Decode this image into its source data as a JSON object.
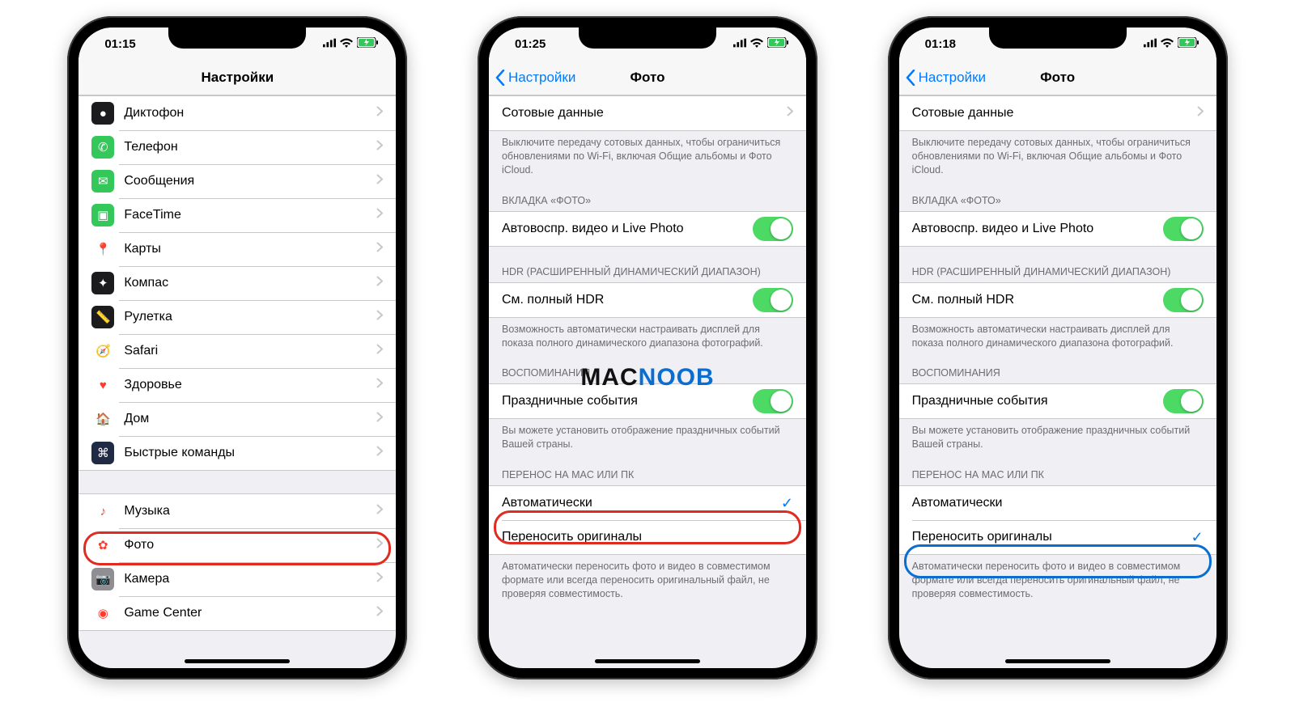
{
  "watermark": {
    "part1": "MAC",
    "part2": "NOOB"
  },
  "phone1": {
    "time": "01:15",
    "title": "Настройки",
    "items_g1": [
      {
        "label": "Диктофон",
        "icon_bg": "#1c1c1e",
        "glyph": "●"
      },
      {
        "label": "Телефон",
        "icon_bg": "#34c759",
        "glyph": "✆"
      },
      {
        "label": "Сообщения",
        "icon_bg": "#34c759",
        "glyph": "✉"
      },
      {
        "label": "FaceTime",
        "icon_bg": "#34c759",
        "glyph": "▣"
      },
      {
        "label": "Карты",
        "icon_bg": "#ffffff",
        "glyph": "📍"
      },
      {
        "label": "Компас",
        "icon_bg": "#1c1c1e",
        "glyph": "✦"
      },
      {
        "label": "Рулетка",
        "icon_bg": "#1c1c1e",
        "glyph": "📏"
      },
      {
        "label": "Safari",
        "icon_bg": "#ffffff",
        "glyph": "🧭"
      },
      {
        "label": "Здоровье",
        "icon_bg": "#ffffff",
        "glyph": "♥"
      },
      {
        "label": "Дом",
        "icon_bg": "#ffffff",
        "glyph": "🏠"
      },
      {
        "label": "Быстрые команды",
        "icon_bg": "#1f2a44",
        "glyph": "⌘"
      }
    ],
    "items_g2": [
      {
        "label": "Музыка",
        "icon_bg": "#ffffff",
        "glyph": "♪"
      },
      {
        "label": "Фото",
        "icon_bg": "#ffffff",
        "glyph": "✿"
      },
      {
        "label": "Камера",
        "icon_bg": "#8e8e93",
        "glyph": "📷"
      },
      {
        "label": "Game Center",
        "icon_bg": "#ffffff",
        "glyph": "◉"
      }
    ]
  },
  "phone2": {
    "time": "01:25",
    "back": "Настройки",
    "title": "Фото",
    "cellular_label": "Сотовые данные",
    "cellular_footer": "Выключите передачу сотовых данных, чтобы ограничиться обновлениями по Wi-Fi, включая Общие альбомы и Фото iCloud.",
    "tab_header": "ВКЛАДКА «ФОТО»",
    "autoplay_label": "Автовоспр. видео и Live Photo",
    "hdr_header": "HDR (РАСШИРЕННЫЙ ДИНАМИЧЕСКИЙ ДИАПАЗОН)",
    "hdr_label": "См. полный HDR",
    "hdr_footer": "Возможность автоматически настраивать дисплей для показа полного динамического диапазона фотографий.",
    "mem_header": "ВОСПОМИНАНИЯ",
    "mem_label": "Праздничные события",
    "mem_footer": "Вы можете установить отображение праздничных событий Вашей страны.",
    "transfer_header": "ПЕРЕНОС НА MAC ИЛИ ПК",
    "opt_auto": "Автоматически",
    "opt_orig": "Переносить оригиналы",
    "transfer_footer": "Автоматически переносить фото и видео в совместимом формате или всегда переносить оригинальный файл, не проверяя совместимость.",
    "selected": "auto"
  },
  "phone3": {
    "time": "01:18",
    "back": "Настройки",
    "title": "Фото",
    "selected": "orig"
  }
}
